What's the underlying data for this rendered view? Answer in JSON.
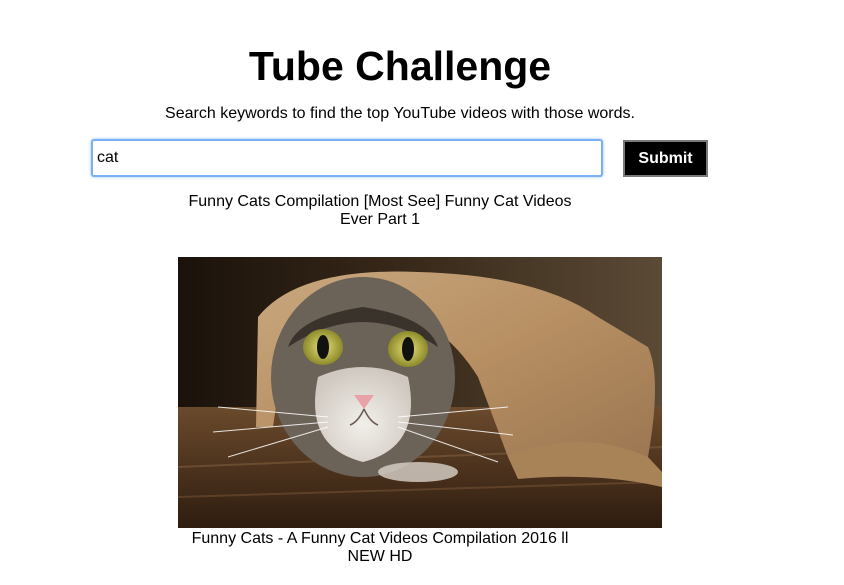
{
  "header": {
    "title": "Tube Challenge",
    "subtitle": "Search keywords to find the top YouTube videos with those words."
  },
  "search": {
    "value": "cat",
    "submit_label": "Submit"
  },
  "results": [
    {
      "title": "Funny Cats Compilation [Most See] Funny Cat Videos Ever Part 1",
      "thumbnail": "cat-in-paper-tube"
    },
    {
      "title": "Funny Cats - A Funny Cat Videos Compilation 2016 ll NEW HD"
    }
  ]
}
